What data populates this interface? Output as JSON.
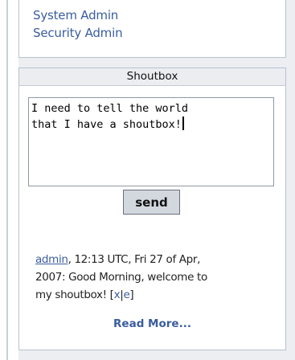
{
  "admin_links": {
    "system_admin": "System Admin",
    "security_admin": "Security Admin"
  },
  "shoutbox": {
    "title": "Shoutbox",
    "input_line1": "I need to tell the world",
    "input_line2": "that I have a shoutbox!",
    "send_label": "send",
    "read_more": "Read More...",
    "message": {
      "author": "admin",
      "text_line1": ", 12:13 UTC, Fri 27 of Apr,",
      "text_line2": "2007: Good Morning, welcome to",
      "text_line3": "my shoutbox! [",
      "delete_action": "x",
      "separator": "|",
      "edit_action": "e",
      "closing_bracket": "]"
    }
  },
  "colors": {
    "link": "#3a5d9f",
    "panel_border": "#b9c2cf",
    "column_background": "#eceef2",
    "button_background": "#d3d7de"
  }
}
